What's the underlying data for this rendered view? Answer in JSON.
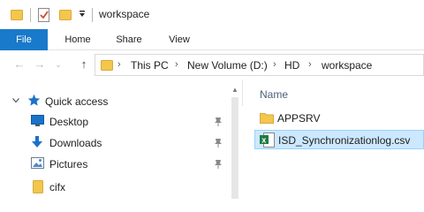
{
  "window": {
    "title": "workspace"
  },
  "quick_access_toolbar": {
    "icons": [
      "folder-icon",
      "properties-check-icon",
      "new-folder-icon",
      "customize-dropdown-icon"
    ]
  },
  "ribbon": {
    "tabs": [
      {
        "label": "File",
        "active": true
      },
      {
        "label": "Home"
      },
      {
        "label": "Share"
      },
      {
        "label": "View"
      }
    ]
  },
  "address_bar": {
    "crumbs": [
      "This PC",
      "New Volume (D:)",
      "HD",
      "workspace"
    ]
  },
  "nav_pane": {
    "quick_access_label": "Quick access",
    "items": [
      {
        "label": "Desktop",
        "icon": "desktop-icon",
        "pinned": true
      },
      {
        "label": "Downloads",
        "icon": "download-icon",
        "pinned": true
      },
      {
        "label": "Pictures",
        "icon": "pictures-icon",
        "pinned": true
      },
      {
        "label": "cifx",
        "icon": "folder-icon",
        "pinned": false
      }
    ]
  },
  "content": {
    "column_header": "Name",
    "files": [
      {
        "label": "APPSRV",
        "icon": "folder-icon",
        "selected": false
      },
      {
        "label": "ISD_Synchronizationlog.csv",
        "icon": "excel-csv-icon",
        "selected": true
      }
    ]
  },
  "colors": {
    "accent": "#1979ca",
    "folder": "#f3c64d",
    "selection": "#cce8ff",
    "selection_border": "#99d1ff",
    "quick_access_star": "#1a73c8"
  }
}
